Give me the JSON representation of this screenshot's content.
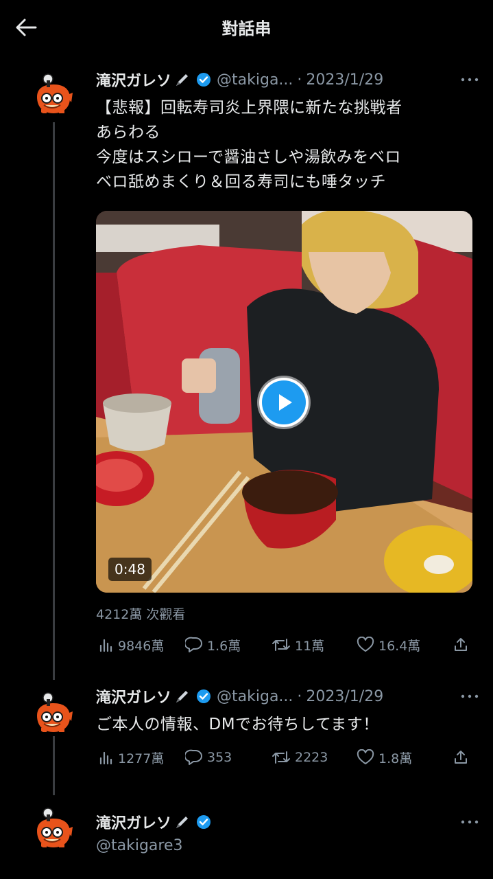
{
  "header": {
    "title": "對話串"
  },
  "tweets": [
    {
      "name": "滝沢ガレソ",
      "handle": "@takiga...",
      "sep": "·",
      "date": "2023/1/29",
      "text_lines": [
        "【悲報】回転寿司炎上界隈に新たな挑戦者",
        "あらわる",
        "今度はスシローで醤油さしや湯飲みをベロ",
        "ベロ舐めまくり＆回る寿司にも唾タッチ"
      ],
      "video": {
        "duration": "0:48"
      },
      "views": "4212萬 次觀看",
      "stats": {
        "views": "9846萬",
        "replies": "1.6萬",
        "retweets": "11萬",
        "likes": "16.4萬"
      }
    },
    {
      "name": "滝沢ガレソ",
      "handle": "@takiga...",
      "sep": "·",
      "date": "2023/1/29",
      "text_lines": [
        "ご本人の情報、DMでお待ちしてます！"
      ],
      "stats": {
        "views": "1277萬",
        "replies": "353",
        "retweets": "2223",
        "likes": "1.8萬"
      }
    },
    {
      "name": "滝沢ガレソ",
      "handle": "@takigare3"
    }
  ],
  "icons": {
    "back": "arrow-left-icon",
    "verified": "verified-badge-icon",
    "pen": "pen-icon",
    "more": "more-dots-icon",
    "analytics": "bar-chart-icon",
    "reply": "reply-bubble-icon",
    "retweet": "retweet-icon",
    "like": "heart-icon",
    "share": "share-icon",
    "play": "play-icon"
  },
  "colors": {
    "background": "#000000",
    "text": "#e7e9ea",
    "secondary": "#8b98a5",
    "accent": "#1d9bf0",
    "avatar": "#e8531b"
  }
}
